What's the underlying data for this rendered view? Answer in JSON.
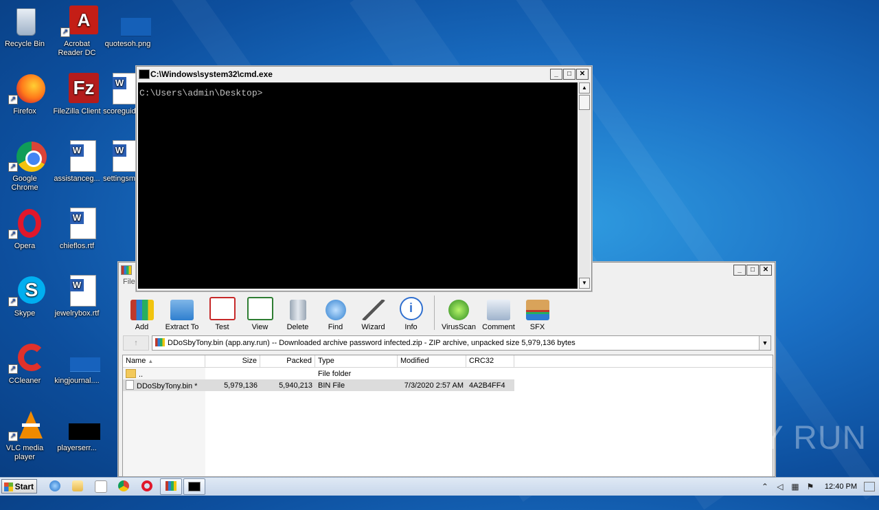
{
  "desktop": {
    "icons": [
      {
        "label": "Recycle Bin"
      },
      {
        "label": "Acrobat Reader DC"
      },
      {
        "label": "quotesoh.png"
      },
      {
        "label": "Firefox"
      },
      {
        "label": "FileZilla Client"
      },
      {
        "label": "scoreguid"
      },
      {
        "label": "Google Chrome"
      },
      {
        "label": "assistanceg..."
      },
      {
        "label": "settingsm"
      },
      {
        "label": "Opera"
      },
      {
        "label": "chieflos.rtf"
      },
      {
        "label": "Skype"
      },
      {
        "label": "jewelrybox.rtf"
      },
      {
        "label": "CCleaner"
      },
      {
        "label": "kingjournal...."
      },
      {
        "label": "VLC media player"
      },
      {
        "label": "playerserr..."
      }
    ]
  },
  "cmd": {
    "title": "C:\\Windows\\system32\\cmd.exe",
    "prompt": "C:\\Users\\admin\\Desktop>"
  },
  "winrar": {
    "menu_first": "File",
    "toolbar": [
      "Add",
      "Extract To",
      "Test",
      "View",
      "Delete",
      "Find",
      "Wizard",
      "Info",
      "VirusScan",
      "Comment",
      "SFX"
    ],
    "up_arrow": "↑",
    "path": "DDoSbyTony.bin (app.any.run) -- Downloaded archive password infected.zip - ZIP archive, unpacked size 5,979,136 bytes",
    "columns": {
      "name": "Name",
      "size": "Size",
      "packed": "Packed",
      "type": "Type",
      "modified": "Modified",
      "crc": "CRC32"
    },
    "rows": [
      {
        "name": "..",
        "size": "",
        "packed": "",
        "type": "File folder",
        "modified": "",
        "crc": ""
      },
      {
        "name": "DDoSbyTony.bin *",
        "size": "5,979,136",
        "packed": "5,940,213",
        "type": "BIN File",
        "modified": "7/3/2020 2:57 AM",
        "crc": "4A2B4FF4"
      }
    ]
  },
  "taskbar": {
    "start": "Start",
    "clock": "12:40 PM"
  },
  "watermark": "ANY RUN",
  "colors": {
    "desktop_bg": "#1a6fc4",
    "console_bg": "#000000",
    "console_fg": "#c0c0c0"
  }
}
